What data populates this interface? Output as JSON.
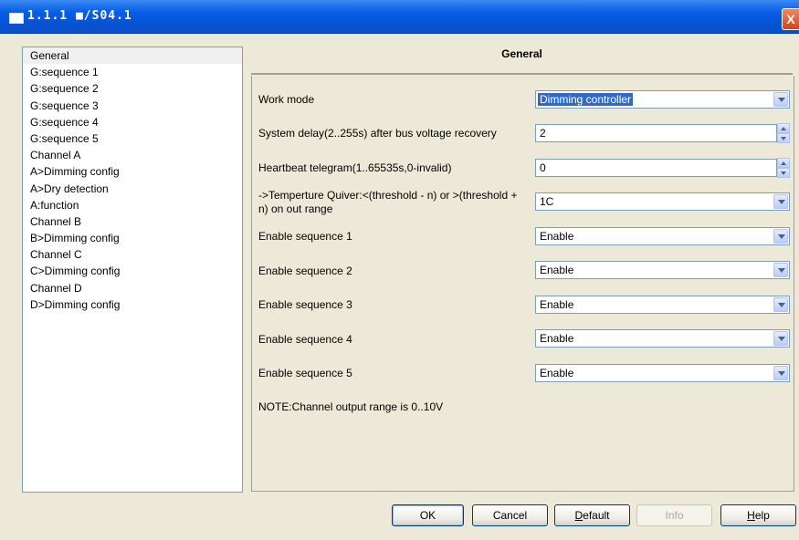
{
  "window": {
    "title": "1.1.1 ■/S04.1",
    "close": "X"
  },
  "tree": {
    "items": [
      "General",
      "G:sequence 1",
      "G:sequence 2",
      "G:sequence 3",
      "G:sequence 4",
      "G:sequence 5",
      "Channel A",
      "A>Dimming config",
      "A>Dry detection",
      "A:function",
      "Channel B",
      "B>Dimming config",
      "Channel C",
      "C>Dimming config",
      "Channel D",
      "D>Dimming config"
    ],
    "selected_index": 0
  },
  "panel": {
    "title": "General",
    "rows": [
      {
        "label": "Work mode",
        "value": "Dimming controller",
        "control": "dropdown",
        "highlighted": true
      },
      {
        "label": "System delay(2..255s) after bus voltage recovery",
        "value": "2",
        "control": "spin"
      },
      {
        "label": "Heartbeat telegram(1..65535s,0-invalid)",
        "value": "0",
        "control": "spin"
      },
      {
        "label": "->Temperture Quiver:<(threshold - n) or >(threshold +",
        "label2": "n) on out range",
        "value": "1C",
        "control": "dropdown"
      },
      {
        "label": "Enable sequence 1",
        "value": "Enable",
        "control": "dropdown"
      },
      {
        "label": "Enable sequence 2",
        "value": "Enable",
        "control": "dropdown"
      },
      {
        "label": "Enable sequence 3",
        "value": "Enable",
        "control": "dropdown"
      },
      {
        "label": "Enable sequence 4",
        "value": "Enable",
        "control": "dropdown"
      },
      {
        "label": "Enable sequence 5",
        "value": "Enable",
        "control": "dropdown"
      }
    ],
    "note": "NOTE:Channel output range is 0..10V"
  },
  "buttons": {
    "ok": "OK",
    "cancel": "Cancel",
    "default_first": "D",
    "default_rest": "efault",
    "info": "Info",
    "help_first": "H",
    "help_rest": "elp"
  }
}
